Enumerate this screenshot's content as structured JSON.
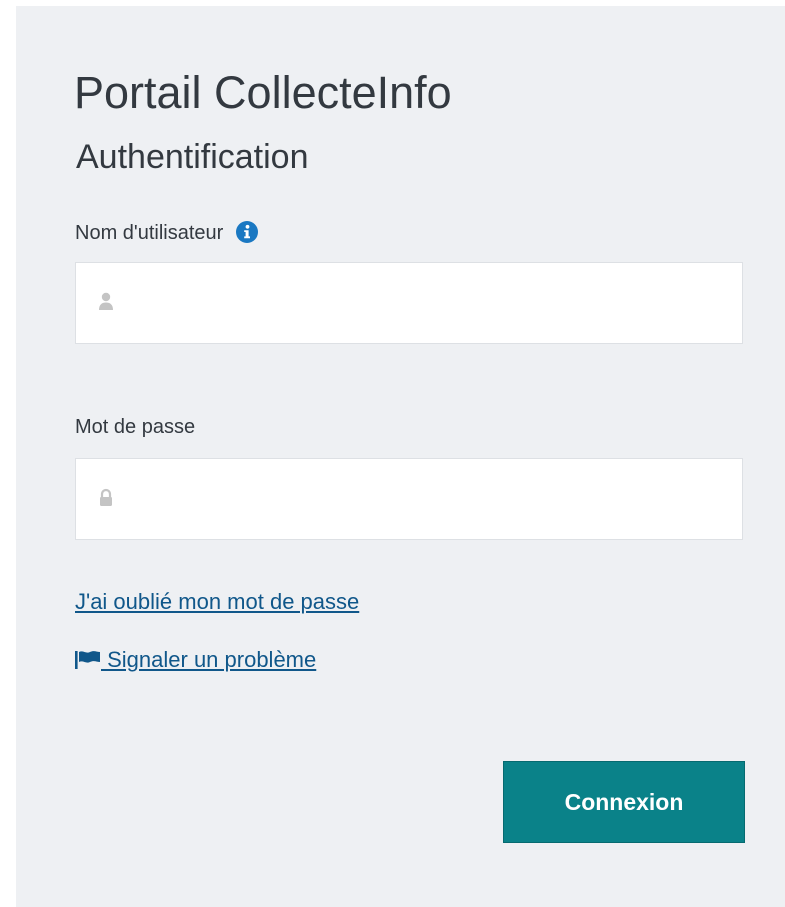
{
  "header": {
    "title": "Portail CollecteInfo",
    "subtitle": "Authentification"
  },
  "form": {
    "username_label": "Nom d'utilisateur",
    "username_value": "",
    "username_placeholder": "",
    "password_label": "Mot de passe",
    "password_value": "",
    "password_placeholder": "",
    "forgot_password_link": "J'ai oublié mon mot de passe",
    "report_problem_link": "Signaler un problème",
    "submit_label": "Connexion"
  },
  "icons": {
    "info": "info-icon",
    "user": "user-icon",
    "lock": "lock-icon",
    "flag": "flag-icon"
  },
  "colors": {
    "panel_background": "#eef0f3",
    "text": "#333940",
    "link": "#10578a",
    "info_icon": "#1a78c2",
    "button": "#0a8289",
    "field_icon": "#c4c4c4"
  }
}
